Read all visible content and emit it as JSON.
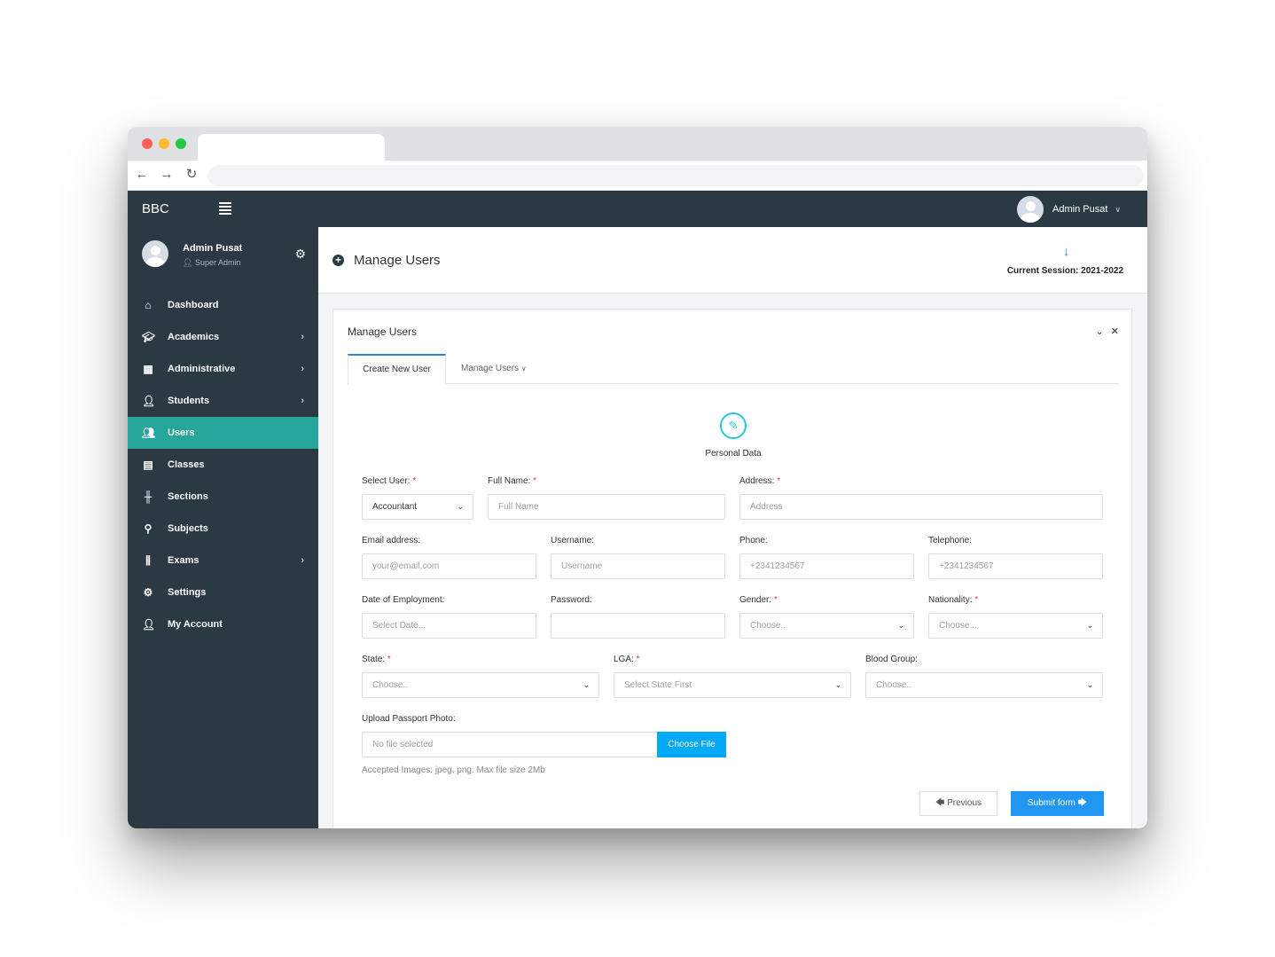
{
  "app": {
    "brand": "BBC",
    "top_user_name": "Admin Pusat"
  },
  "sidebar": {
    "profile_name": "Admin Pusat",
    "profile_role": "Super Admin",
    "items": [
      {
        "label": "Dashboard",
        "icon": "home-icon",
        "has_arrow": false
      },
      {
        "label": "Academics",
        "icon": "graduation-cap-icon",
        "has_arrow": true
      },
      {
        "label": "Administrative",
        "icon": "building-icon",
        "has_arrow": true
      },
      {
        "label": "Students",
        "icon": "student-icon",
        "has_arrow": true
      },
      {
        "label": "Users",
        "icon": "users-icon",
        "has_arrow": false,
        "active": true
      },
      {
        "label": "Classes",
        "icon": "classes-icon",
        "has_arrow": false
      },
      {
        "label": "Sections",
        "icon": "sections-icon",
        "has_arrow": false
      },
      {
        "label": "Subjects",
        "icon": "map-pin-icon",
        "has_arrow": false
      },
      {
        "label": "Exams",
        "icon": "library-icon",
        "has_arrow": true
      },
      {
        "label": "Settings",
        "icon": "gear-icon",
        "has_arrow": false
      },
      {
        "label": "My Account",
        "icon": "user-icon",
        "has_arrow": false
      }
    ]
  },
  "header": {
    "title": "Manage Users",
    "session": "Current Session: 2021-2022"
  },
  "card": {
    "title": "Manage Users",
    "tabs": [
      "Create New User",
      "Manage Users"
    ],
    "step_label": "Personal Data"
  },
  "form": {
    "select_user": {
      "label": "Select User:",
      "value": "Accountant"
    },
    "full_name": {
      "label": "Full Name:",
      "placeholder": "Full Name"
    },
    "address": {
      "label": "Address:",
      "placeholder": "Address"
    },
    "email": {
      "label": "Email address:",
      "placeholder": "your@email.com"
    },
    "username": {
      "label": "Username:",
      "placeholder": "Username"
    },
    "phone": {
      "label": "Phone:",
      "placeholder": "+2341234567"
    },
    "telephone": {
      "label": "Telephone:",
      "placeholder": "+2341234567"
    },
    "employment_date": {
      "label": "Date of Employment:",
      "placeholder": "Select Date..."
    },
    "password": {
      "label": "Password:",
      "placeholder": ""
    },
    "gender": {
      "label": "Gender:",
      "value": "Choose.."
    },
    "nationality": {
      "label": "Nationality:",
      "value": "Choose..."
    },
    "state": {
      "label": "State:",
      "value": "Choose.."
    },
    "lga": {
      "label": "LGA:",
      "value": "Select State First"
    },
    "blood_group": {
      "label": "Blood Group:",
      "value": "Choose.."
    },
    "upload": {
      "label": "Upload Passport Photo:",
      "status": "No file selected",
      "button": "Choose File",
      "hint": "Accepted Images: jpeg, png. Max file size 2Mb"
    },
    "required_mark": "*"
  },
  "actions": {
    "previous": "Previous",
    "submit": "Submit form"
  },
  "colors": {
    "sidebar_bg": "#2b3a42",
    "active_item": "#26a69a",
    "primary": "#2196f3"
  }
}
